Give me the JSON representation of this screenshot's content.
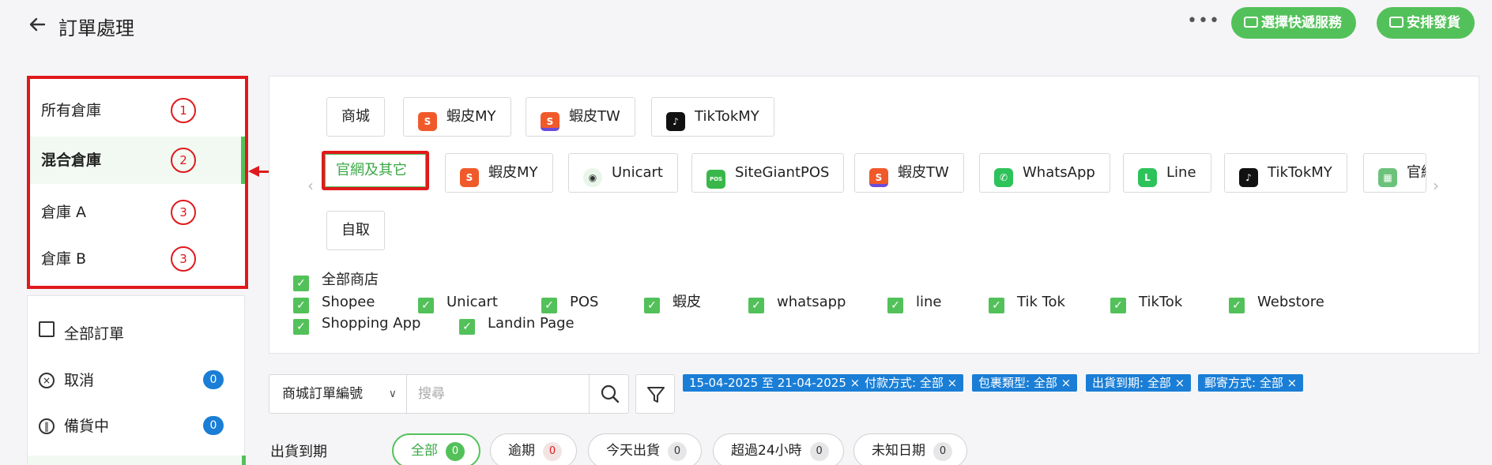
{
  "header": {
    "title": "訂單處理",
    "more_label": "•••",
    "btn_express": "選擇快遞服務",
    "btn_ship": "安排發貨"
  },
  "warehouses": [
    {
      "label": "所有倉庫",
      "num": "1"
    },
    {
      "label": "混合倉庫",
      "num": "2"
    },
    {
      "label": "倉庫 A",
      "num": "3"
    },
    {
      "label": "倉庫 B",
      "num": "3"
    }
  ],
  "status": [
    {
      "label": "全部訂單"
    },
    {
      "label": "取消",
      "count": "0"
    },
    {
      "label": "備貨中",
      "count": "0"
    }
  ],
  "channels_row1": [
    {
      "label": "商城"
    },
    {
      "label": "蝦皮MY"
    },
    {
      "label": "蝦皮TW"
    },
    {
      "label": "TikTokMY"
    }
  ],
  "channels_row2": [
    {
      "label": "官網及其它"
    },
    {
      "label": "蝦皮MY"
    },
    {
      "label": "Unicart"
    },
    {
      "label": "SiteGiantPOS"
    },
    {
      "label": "蝦皮TW"
    },
    {
      "label": "WhatsApp"
    },
    {
      "label": "Line"
    },
    {
      "label": "TikTokMY"
    },
    {
      "label": "官網"
    }
  ],
  "channels_row3": [
    {
      "label": "自取"
    }
  ],
  "stores": {
    "all": "全部商店",
    "items": [
      "Shopee",
      "Unicart",
      "POS",
      "蝦皮",
      "whatsapp",
      "line",
      "Tik Tok",
      "TikTok",
      "Webstore",
      "Shopping App",
      "Landin Page"
    ]
  },
  "search": {
    "field_label": "商城訂單編號",
    "placeholder": "搜尋"
  },
  "tags": [
    "15-04-2025 至 21-04-2025",
    "付款方式: 全部",
    "包裹類型: 全部",
    "出貨到期: 全部",
    "郵寄方式: 全部"
  ],
  "due": {
    "label": "出貨到期",
    "pills": [
      {
        "label": "全部",
        "count": "0"
      },
      {
        "label": "逾期",
        "count": "0"
      },
      {
        "label": "今天出貨",
        "count": "0"
      },
      {
        "label": "超過24小時",
        "count": "0"
      },
      {
        "label": "未知日期",
        "count": "0"
      }
    ]
  },
  "colors": {
    "accent": "#53c15a",
    "annotation": "#e0191d",
    "badge": "#1a7ed6"
  },
  "icons": {
    "tiktok_glyph": "♪",
    "pos_glyph": "POS",
    "unicart_glyph": "◉",
    "chat_glyph": "✆",
    "check_glyph": "✓",
    "close_glyph": "×"
  }
}
